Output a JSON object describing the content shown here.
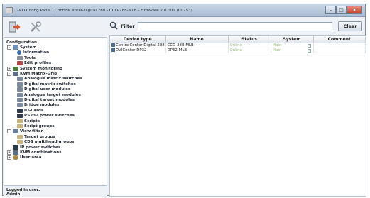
{
  "window": {
    "title": "G&D Config Panel | ControlCenter-Digital 288 - CCD-288-MLB - Firmware 2.0.001 (00753)",
    "buttons": [
      "–",
      "□",
      "x"
    ]
  },
  "toolbar": {
    "icons": [
      "logout-icon",
      "tools-icon"
    ]
  },
  "filter": {
    "label": "Filter",
    "value": "",
    "clear_label": "Clear"
  },
  "tree": {
    "items": [
      {
        "label": "Configuration",
        "level": 0,
        "icon": "",
        "expander": ""
      },
      {
        "label": "System",
        "level": 1,
        "icon": "system-icon",
        "expander": "-"
      },
      {
        "label": "Information",
        "level": 2,
        "icon": "info-icon",
        "expander": ""
      },
      {
        "label": "Tools",
        "level": 2,
        "icon": "tools-icon",
        "expander": ""
      },
      {
        "label": "Edit profiles",
        "level": 2,
        "icon": "profiles-icon",
        "expander": ""
      },
      {
        "label": "System monitoring",
        "level": 1,
        "icon": "monitoring-icon",
        "expander": "+"
      },
      {
        "label": "KVM Matrix-Grid",
        "level": 1,
        "icon": "grid-icon",
        "expander": "-"
      },
      {
        "label": "Analogue matrix switches",
        "level": 2,
        "icon": "module-icon",
        "expander": ""
      },
      {
        "label": "Digital matrix switches",
        "level": 2,
        "icon": "module-icon",
        "expander": ""
      },
      {
        "label": "Digital user modules",
        "level": 2,
        "icon": "module-icon",
        "expander": ""
      },
      {
        "label": "Analogue target modules",
        "level": 2,
        "icon": "module-icon",
        "expander": ""
      },
      {
        "label": "Digital target modules",
        "level": 2,
        "icon": "module-icon",
        "expander": ""
      },
      {
        "label": "Bridge modules",
        "level": 2,
        "icon": "module-icon",
        "expander": ""
      },
      {
        "label": "IO-Cards",
        "level": 2,
        "icon": "card-icon",
        "expander": ""
      },
      {
        "label": "RS232 power switches",
        "level": 2,
        "icon": "power-icon",
        "expander": ""
      },
      {
        "label": "Scripts",
        "level": 2,
        "icon": "script-icon",
        "expander": ""
      },
      {
        "label": "Script groups",
        "level": 2,
        "icon": "script-icon",
        "expander": ""
      },
      {
        "label": "View filter",
        "level": 1,
        "icon": "filter-icon",
        "expander": "-"
      },
      {
        "label": "Target groups",
        "level": 2,
        "icon": "group-icon",
        "expander": ""
      },
      {
        "label": "CDS multihead groups",
        "level": 2,
        "icon": "group-icon",
        "expander": ""
      },
      {
        "label": "IP power switches",
        "level": 1,
        "icon": "power-icon",
        "expander": ""
      },
      {
        "label": "KVM combinations",
        "level": 1,
        "icon": "kvm-icon",
        "expander": "+"
      },
      {
        "label": "User area",
        "level": 1,
        "icon": "user-icon",
        "expander": "+"
      }
    ]
  },
  "status": {
    "logged_in_label": "Logged in user:",
    "user": "Admin"
  },
  "table": {
    "columns": [
      "Device type",
      "Name",
      "Status",
      "System",
      "Comment"
    ],
    "rows": [
      {
        "device_type": "ControlCenter-Digital 288",
        "name": "CCD-288-MLB",
        "status": "Online",
        "system": "Main",
        "comment": ""
      },
      {
        "device_type": "DVICenter DP32",
        "name": "DP32-MLB",
        "status": "Online",
        "system": "Main",
        "comment": ""
      }
    ]
  },
  "colors": {
    "online_text": "#9bc07e",
    "titlebar": "#b7c8dc"
  }
}
